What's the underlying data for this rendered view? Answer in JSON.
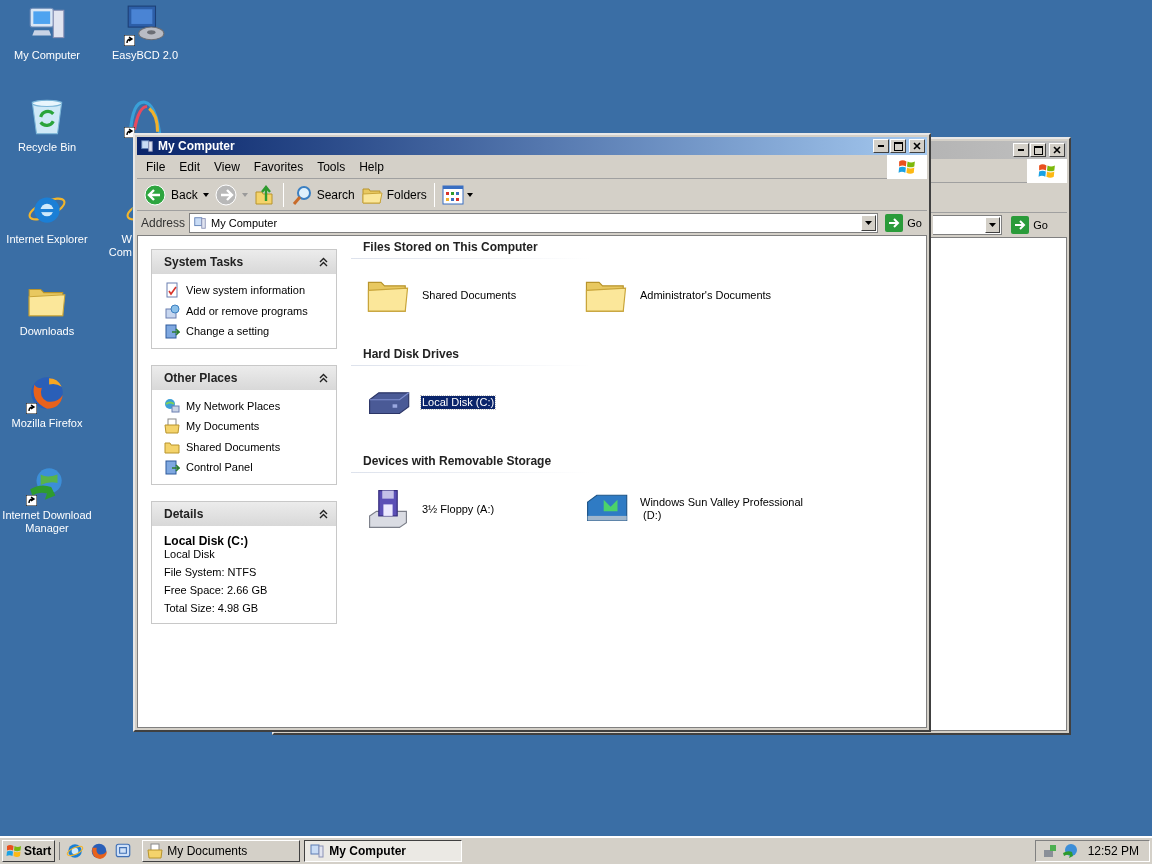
{
  "desktop": {
    "columns": [
      [
        {
          "label": [
            "My Computer"
          ],
          "kind": "computer",
          "cut_by_window": false
        },
        {
          "label": [
            "Recycle Bin"
          ],
          "kind": "recycle",
          "cut_by_window": false
        },
        {
          "label": [
            "Internet Explorer"
          ],
          "kind": "ie",
          "cut_by_window": false
        },
        {
          "label": [
            "Downloads"
          ],
          "kind": "folder",
          "cut_by_window": false
        },
        {
          "label": [
            "Mozilla Firefox"
          ],
          "kind": "firefox",
          "cut_by_window": false
        },
        {
          "label": [
            "Internet Download",
            "Manager"
          ],
          "kind": "idm",
          "cut_by_window": false
        }
      ],
      [
        {
          "label": [
            "EasyBCD 2.0"
          ],
          "kind": "easybcd",
          "cut_by_window": false
        },
        {
          "kind": "curve"
        },
        {
          "label": [
            "W",
            "Com"
          ],
          "kind": "ie",
          "cut_by_window": true
        }
      ]
    ]
  },
  "back_window": {
    "go": "Go"
  },
  "window": {
    "title": "My Computer",
    "active": true,
    "menu": [
      "File",
      "Edit",
      "View",
      "Favorites",
      "Tools",
      "Help"
    ],
    "toolbar": [
      {
        "kind": "back",
        "label": "Back",
        "disabled": false
      },
      {
        "kind": "forward",
        "disabled": true
      },
      {
        "kind": "up",
        "disabled": false
      },
      {
        "kind": "separator"
      },
      {
        "kind": "search",
        "label": "Search",
        "disabled": false
      },
      {
        "kind": "folders",
        "label": "Folders",
        "disabled": false
      },
      {
        "kind": "separator"
      },
      {
        "kind": "views",
        "disabled": false
      }
    ],
    "address": {
      "label": "Address",
      "value": "My Computer",
      "go": "Go"
    },
    "sidebar": [
      {
        "title": "System Tasks",
        "kind": "tasks",
        "items": [
          "View system information",
          "Add or remove programs",
          "Change a setting"
        ]
      },
      {
        "title": "Other Places",
        "kind": "tasks",
        "items": [
          "My Network Places",
          "My Documents",
          "Shared Documents",
          "Control Panel"
        ]
      },
      {
        "title": "Details",
        "kind": "details",
        "name": "Local Disk (C:)",
        "lines": [
          "Local Disk",
          "File System: NTFS",
          "Free Space: 2.66 GB",
          "Total Size: 4.98 GB"
        ]
      }
    ],
    "groups": [
      {
        "title": "Files Stored on This Computer",
        "items": [
          {
            "label": [
              "Shared Documents"
            ],
            "kind": "folder",
            "selected": false
          },
          {
            "label": [
              "Administrator's Documents"
            ],
            "kind": "folder",
            "selected": false
          }
        ]
      },
      {
        "title": "Hard Disk Drives",
        "items": [
          {
            "label": [
              "Local Disk (C:)"
            ],
            "kind": "harddisk",
            "selected": true
          }
        ]
      },
      {
        "title": "Devices with Removable Storage",
        "items": [
          {
            "label": [
              "3½ Floppy (A:)"
            ],
            "kind": "floppy",
            "selected": false
          },
          {
            "label": [
              "Windows Sun Valley Professional",
              " (D:)"
            ],
            "kind": "cd",
            "selected": false
          }
        ]
      }
    ]
  },
  "taskbar": {
    "start": "Start",
    "tasks": [
      {
        "label": "My Documents",
        "selected": false
      },
      {
        "label": "My Computer",
        "selected": true
      }
    ],
    "clock": "12:52 PM"
  }
}
